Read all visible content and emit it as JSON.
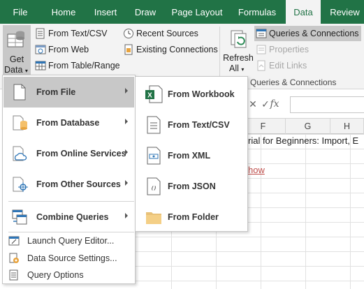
{
  "tabs": [
    "File",
    "Home",
    "Insert",
    "Draw",
    "Page Layout",
    "Formulas",
    "Data",
    "Review"
  ],
  "active_tab": "Data",
  "ribbon": {
    "get_data_line1": "Get",
    "get_data_line2": "Data",
    "from_text_csv": "From Text/CSV",
    "from_web": "From Web",
    "from_table_range": "From Table/Range",
    "recent_sources": "Recent Sources",
    "existing_connections": "Existing Connections",
    "refresh_line1": "Refresh",
    "refresh_line2": "All",
    "queries_connections": "Queries & Connections",
    "properties": "Properties",
    "edit_links": "Edit Links",
    "group_label": "Queries & Connections"
  },
  "formula_bar": {
    "cancel": "✕",
    "enter": "✓",
    "fx": "fx"
  },
  "columns": [
    "F",
    "G",
    "H"
  ],
  "sheet": {
    "cell_text": "rial for Beginners: Import, E",
    "cell_link": "how"
  },
  "menu": {
    "items": [
      {
        "label": "From File",
        "icon": "file-icon"
      },
      {
        "label": "From Database",
        "icon": "database-icon"
      },
      {
        "label": "From Online Services",
        "icon": "cloud-icon"
      },
      {
        "label": "From Other Sources",
        "icon": "other-sources-icon"
      },
      {
        "label": "Combine Queries",
        "icon": "combine-icon"
      }
    ],
    "small_items": [
      {
        "label": "Launch Query Editor...",
        "icon": "query-editor-icon"
      },
      {
        "label": "Data Source Settings...",
        "icon": "data-source-settings-icon"
      },
      {
        "label": "Query Options",
        "icon": "query-options-icon"
      }
    ]
  },
  "submenu": {
    "items": [
      {
        "label": "From Workbook",
        "icon": "excel-workbook-icon"
      },
      {
        "label": "From Text/CSV",
        "icon": "text-file-icon"
      },
      {
        "label": "From XML",
        "icon": "xml-file-icon"
      },
      {
        "label": "From JSON",
        "icon": "json-file-icon"
      },
      {
        "label": "From Folder",
        "icon": "folder-icon"
      }
    ]
  },
  "colors": {
    "excel_green": "#217346",
    "ribbon_bg": "#f3f3f3",
    "menu_hover": "#c8c8c8",
    "link_red": "#c0504d"
  }
}
